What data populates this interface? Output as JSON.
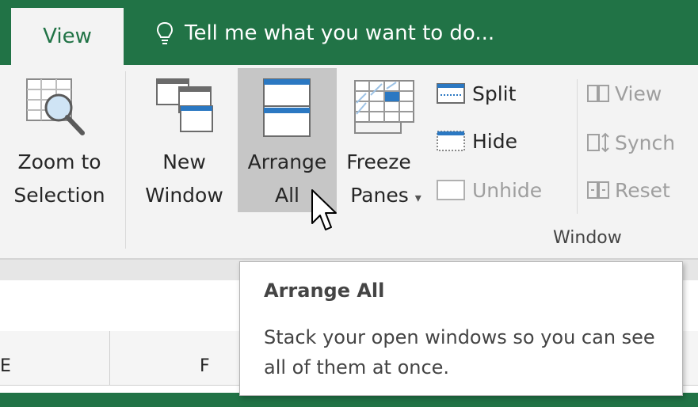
{
  "tabs": {
    "active": "View"
  },
  "tell_me": {
    "text": "Tell me what you want to do..."
  },
  "ribbon": {
    "zoom_selection": {
      "line1": "Zoom to",
      "line2": "Selection"
    },
    "new_window": {
      "line1": "New",
      "line2": "Window"
    },
    "arrange_all": {
      "line1": "Arrange",
      "line2": "All"
    },
    "freeze_panes": {
      "line1": "Freeze",
      "line2": "Panes",
      "caret": "▾"
    },
    "split": "Split",
    "hide": "Hide",
    "unhide": "Unhide",
    "view_side": "View",
    "sync": "Synch",
    "reset": "Reset",
    "group_label": "Window"
  },
  "sheet": {
    "col_left": "E",
    "col_f": "F"
  },
  "tooltip": {
    "title": "Arrange All",
    "description": "Stack your open windows so you can see all of them at once."
  },
  "colors": {
    "excel_green": "#217346",
    "ribbon_bg": "#f3f3f3",
    "hover": "#c6c6c6",
    "accent_blue": "#2b78c2"
  }
}
